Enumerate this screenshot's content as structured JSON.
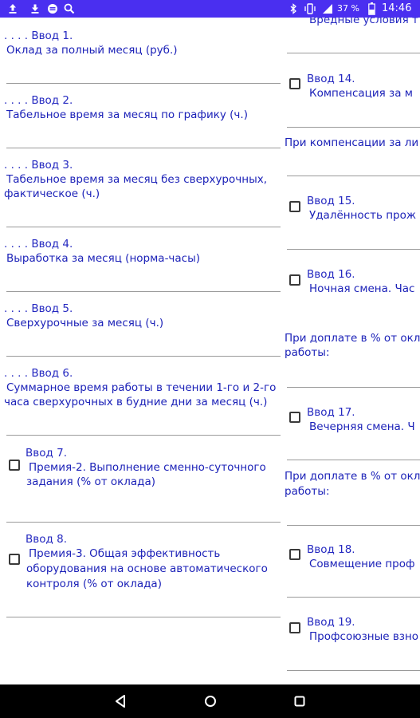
{
  "status": {
    "icons": [
      "upload-icon",
      "download-icon",
      "media-icon",
      "search-icon",
      "bluetooth-icon",
      "vibrate-icon",
      "battery-icon"
    ],
    "battery": "37 %",
    "time": "14:46"
  },
  "left": {
    "inputs": [
      {
        "label": ". . . . Ввод 1.",
        "text": "Оклад за полный месяц (руб.)"
      },
      {
        "label": ". . . . Ввод 2.",
        "text": "Табельное время за месяц по графику (ч.)"
      },
      {
        "label": ". . . . Ввод 3.",
        "line1": "Табельное время за месяц без сверхурочных,",
        "line2": "фактическое (ч.)"
      },
      {
        "label": ". . . . Ввод 4.",
        "text": "Выработка за месяц (норма-часы)"
      },
      {
        "label": ". . . . Ввод 5.",
        "text": "Сверхурочные за месяц (ч.)"
      },
      {
        "label": ". . . . Ввод 6.",
        "line1": "Суммарное время работы в течении 1-го и 2-го",
        "line2": "часа сверхурочных в будние дни за месяц (ч.)"
      },
      {
        "label": "Ввод 7.",
        "line1": "Премия-2. Выполнение сменно-суточного",
        "line2": "задания (% от оклада)"
      },
      {
        "label": "Ввод 8.",
        "line1": "Премия-3. Общая эффективность",
        "line2": "оборудования на основе автоматического",
        "line3": "контроля (% от оклада)"
      }
    ]
  },
  "right": {
    "top_partial": "Вредные условия т",
    "input14": {
      "label": "Ввод 14.",
      "text": "Компенсация за м"
    },
    "note1": "При компенсации за ли",
    "input15": {
      "label": "Ввод 15.",
      "text": "Удалённость прож"
    },
    "input16": {
      "label": "Ввод 16.",
      "text": "Ночная смена. Час"
    },
    "note2": {
      "line1": "При доплате в % от окл",
      "line2": "работы:"
    },
    "input17": {
      "label": "Ввод 17.",
      "text": "Вечерняя смена. Ч"
    },
    "note3": {
      "line1": "При доплате в % от окл",
      "line2": "работы:"
    },
    "input18": {
      "label": "Ввод 18.",
      "text": "Совмещение проф"
    },
    "input19": {
      "label": "Ввод 19.",
      "text": "Профсоюзные взно"
    }
  },
  "nav": {
    "icons": [
      "back-icon",
      "home-icon",
      "recents-icon"
    ]
  }
}
